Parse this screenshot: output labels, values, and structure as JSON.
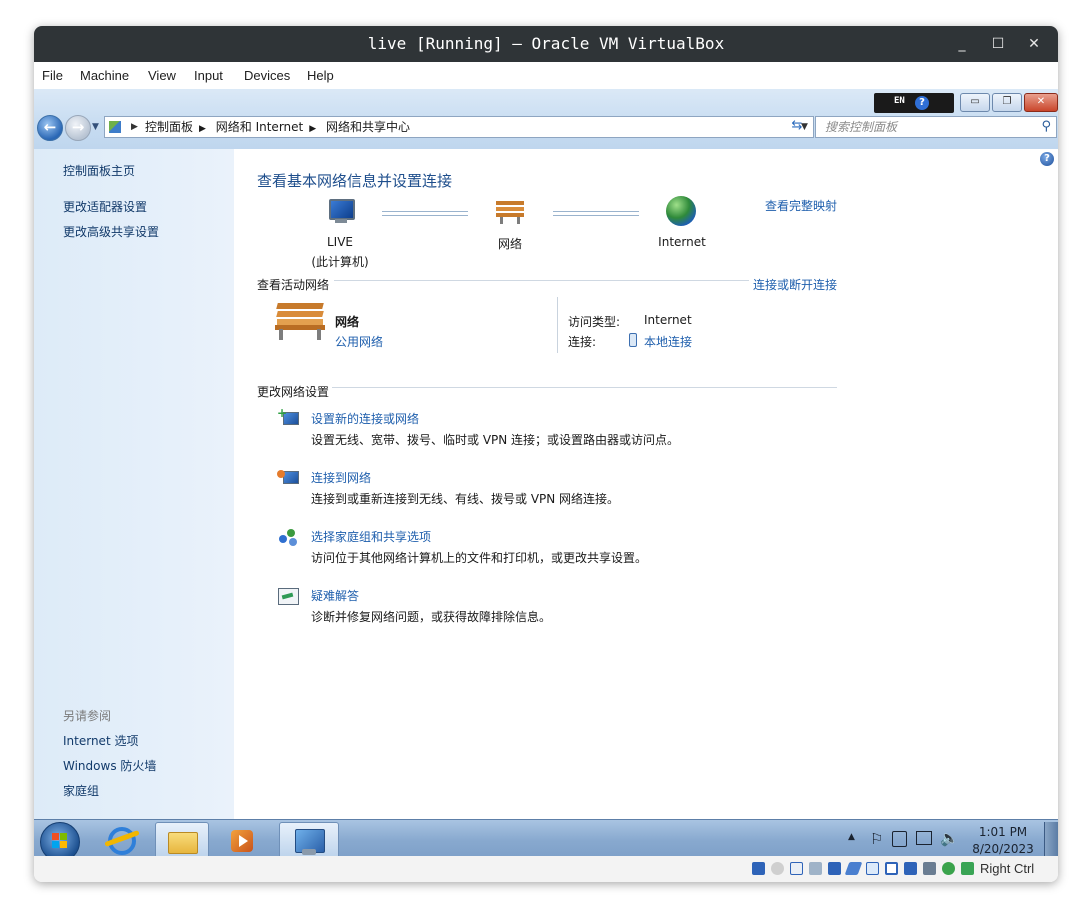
{
  "window": {
    "title": "live [Running] – Oracle VM VirtualBox",
    "minimize_glyph": "_",
    "maximize_glyph": "☐",
    "close_glyph": "✕"
  },
  "menubar": {
    "items": [
      "File",
      "Machine",
      "View",
      "Input",
      "Devices",
      "Help"
    ]
  },
  "langbar": {
    "lang": "EN",
    "help": "?"
  },
  "address": {
    "crumbs": [
      "控制面板",
      "网络和 Internet",
      "网络和共享中心"
    ]
  },
  "search": {
    "placeholder": "搜索控制面板"
  },
  "sidebar": {
    "home": "控制面板主页",
    "adapter": "更改适配器设置",
    "advanced": "更改高级共享设置",
    "see_also": "另请参阅",
    "internet_options": "Internet 选项",
    "firewall": "Windows 防火墙",
    "homegroup": "家庭组"
  },
  "main": {
    "heading": "查看基本网络信息并设置连接",
    "full_map": "查看完整映射",
    "map": {
      "computer_line1": "LIVE",
      "computer_line2": "(此计算机)",
      "network": "网络",
      "internet": "Internet"
    },
    "active_header": "查看活动网络",
    "connect_disconnect": "连接或断开连接",
    "network_name": "网络",
    "network_type": "公用网络",
    "access_type_label": "访问类型:",
    "access_type_value": "Internet",
    "connection_label": "连接:",
    "connection_value": "本地连接",
    "change_header": "更改网络设置",
    "tasks": [
      {
        "title": "设置新的连接或网络",
        "desc": "设置无线、宽带、拨号、临时或 VPN 连接；或设置路由器或访问点。"
      },
      {
        "title": "连接到网络",
        "desc": "连接到或重新连接到无线、有线、拨号或 VPN 网络连接。"
      },
      {
        "title": "选择家庭组和共享选项",
        "desc": "访问位于其他网络计算机上的文件和打印机，或更改共享设置。"
      },
      {
        "title": "疑难解答",
        "desc": "诊断并修复网络问题，或获得故障排除信息。"
      }
    ]
  },
  "taskbar": {
    "time": "1:01 PM",
    "date": "8/20/2023"
  },
  "statusbar": {
    "host_key": "Right Ctrl"
  },
  "colors": {
    "link": "#1f5fad",
    "heading": "#1e4e8c",
    "titlebar": "#2f3437",
    "sidebar": "#e3eef9",
    "taskbar": "#8fb0d5"
  }
}
